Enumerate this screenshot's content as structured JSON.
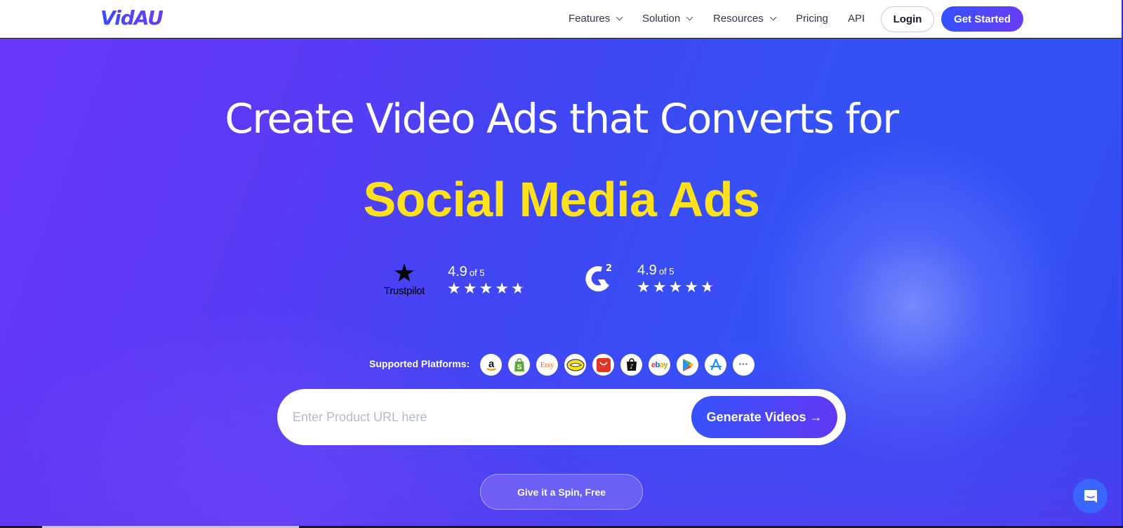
{
  "header": {
    "logo": "VidAU",
    "nav": [
      {
        "label": "Features",
        "has_dropdown": true
      },
      {
        "label": "Solution",
        "has_dropdown": true
      },
      {
        "label": "Resources",
        "has_dropdown": true
      },
      {
        "label": "Pricing",
        "has_dropdown": false
      },
      {
        "label": "API",
        "has_dropdown": false
      }
    ],
    "login_label": "Login",
    "get_started_label": "Get Started"
  },
  "hero": {
    "headline": "Create Video Ads that Converts for",
    "highlight": "Social Media Ads",
    "highlight_color": "#fde11a",
    "ratings": [
      {
        "source": "Trustpilot",
        "score": "4.9",
        "of": "of 5",
        "stars": 4.5
      },
      {
        "source": "G2",
        "score": "4.9",
        "of": "of 5",
        "stars": 4.5
      }
    ],
    "platforms_label": "Supported Platforms:",
    "platforms": [
      {
        "name": "Amazon",
        "icon": "amazon-icon"
      },
      {
        "name": "Shopify",
        "icon": "shopify-icon"
      },
      {
        "name": "Etsy",
        "icon": "etsy-icon",
        "text": "Etsy"
      },
      {
        "name": "Mercado Libre",
        "icon": "mercadolibre-icon"
      },
      {
        "name": "AliExpress",
        "icon": "aliexpress-icon"
      },
      {
        "name": "TikTok Shop",
        "icon": "tiktok-shop-icon"
      },
      {
        "name": "eBay",
        "icon": "ebay-icon",
        "text": "ebay"
      },
      {
        "name": "Google Play",
        "icon": "google-play-icon"
      },
      {
        "name": "App Store",
        "icon": "app-store-icon"
      },
      {
        "name": "More",
        "icon": "more-icon",
        "text": "•••"
      }
    ],
    "url_input": {
      "value": "",
      "placeholder": "Enter Product URL here"
    },
    "generate_label": "Generate Videos →",
    "spin_label": "Give it a Spin, Free"
  },
  "colors": {
    "brand_blue": "#3553fb",
    "brand_purple": "#6a3cf5",
    "chat_button": "#3a66ff"
  }
}
